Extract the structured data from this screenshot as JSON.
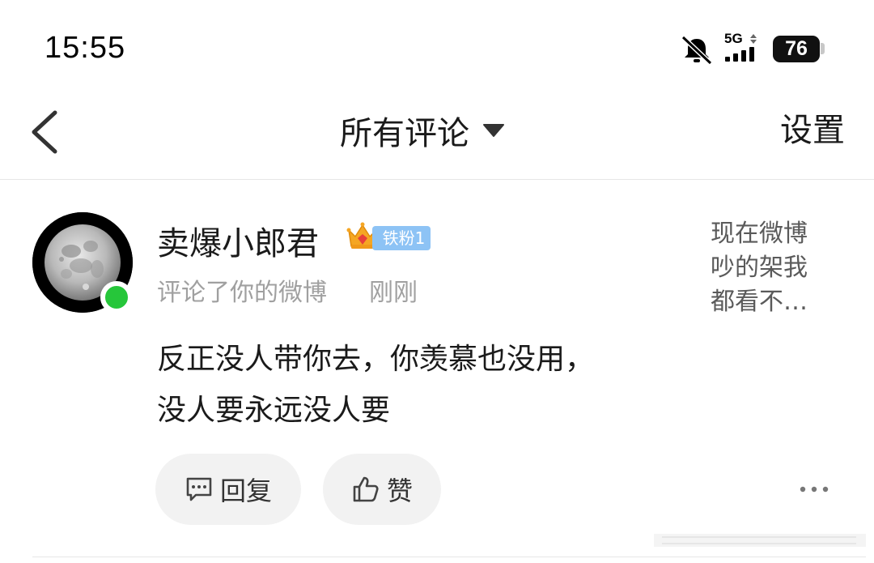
{
  "status_bar": {
    "time": "15:55",
    "network": "5G",
    "battery": "76",
    "icons": [
      "bell-muted-icon",
      "signal-icon",
      "battery-icon"
    ]
  },
  "nav": {
    "title": "所有评论",
    "settings_label": "设置",
    "icons": [
      "back-chevron-icon",
      "dropdown-triangle-icon"
    ]
  },
  "comment": {
    "username": "卖爆小郎君",
    "fan_badge": "铁粉1",
    "action": "评论了你的微博",
    "time": "刚刚",
    "text_line1": "反正没人带你去，你羡慕也没用，",
    "text_line2": "没人要永远没人要",
    "preview": "现在微博吵的架我都看不…",
    "reply_label": "回复",
    "like_label": "赞",
    "colors": {
      "online_dot": "#26c63a",
      "badge": "#8dc3f5",
      "crown": "#f5a623"
    },
    "icons": [
      "avatar-moon",
      "crown-icon",
      "comment-icon",
      "thumbs-up-icon",
      "more-dots-icon"
    ]
  }
}
